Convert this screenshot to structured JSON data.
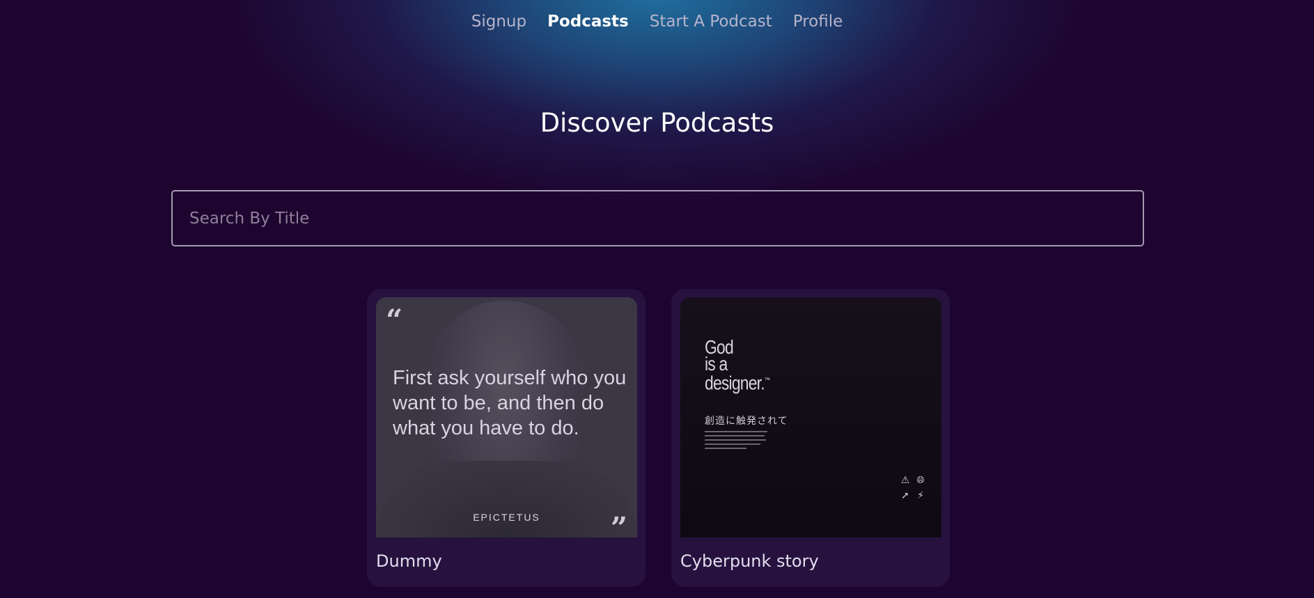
{
  "nav": {
    "items": [
      {
        "label": "Signup",
        "active": false
      },
      {
        "label": "Podcasts",
        "active": true
      },
      {
        "label": "Start A Podcast",
        "active": false
      },
      {
        "label": "Profile",
        "active": false
      }
    ]
  },
  "page": {
    "title": "Discover Podcasts"
  },
  "search": {
    "placeholder": "Search By Title",
    "value": ""
  },
  "podcasts": [
    {
      "title": "Dummy",
      "image": {
        "quote": "First ask yourself who you want to be, and then do what you have to do.",
        "author": "EPICTETUS",
        "open_mark": "“",
        "close_mark": "”"
      }
    },
    {
      "title": "Cyberpunk story",
      "image": {
        "headline_line1": "God",
        "headline_line2": "is a",
        "headline_line3": "designer.",
        "trademark": "™",
        "japanese": "創造に触発されて",
        "icons": [
          "warning-icon",
          "globe-icon",
          "cursor-icon",
          "bolt-icon"
        ]
      }
    }
  ],
  "colors": {
    "background": "#1e0530",
    "glow": "#1f70a0",
    "card": "#27123f",
    "nav_inactive": "#b7b4cc",
    "nav_active": "#ffffff"
  }
}
